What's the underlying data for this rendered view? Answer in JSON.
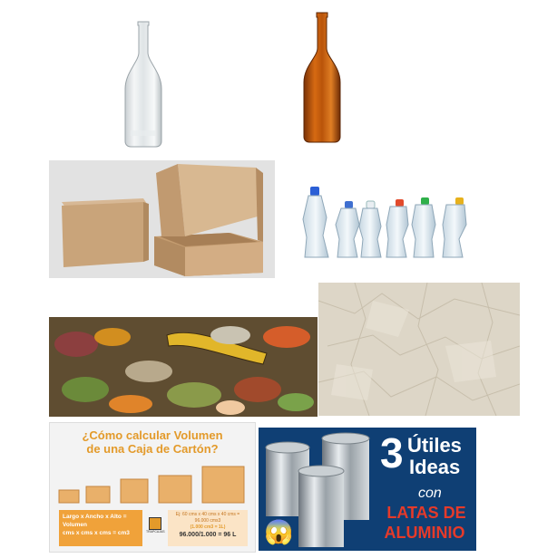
{
  "tiles": [
    {
      "name": "clear-glass-bottle"
    },
    {
      "name": "amber-glass-bottle"
    },
    {
      "name": "cardboard-boxes"
    },
    {
      "name": "crushed-plastic-bottles"
    },
    {
      "name": "organic-waste"
    },
    {
      "name": "crumpled-paper"
    }
  ],
  "box_volume": {
    "title_line1": "¿Cómo calcular Volumen",
    "title_line2": "de una Caja de Cartón?",
    "formula_line1": "Largo x Ancho x Alto =",
    "formula_line2": "Volumen",
    "formula_line3": "cms x cms x cms = cm3",
    "example_line1": "Ej: 60 cms x 40 cms x 40 cms =",
    "example_line2": "96.000 cms3",
    "example_line3": "(1.000 cm3 = 1L)",
    "result": "96.000/1.000 = 96 L",
    "logo_text": "TRAPCAJAS"
  },
  "cans": {
    "number": "3",
    "word1": "Útiles",
    "word2": "Ideas",
    "word3": "con",
    "word4": "LATAS DE",
    "word5": "ALUMINIO",
    "emoji": "😱"
  }
}
